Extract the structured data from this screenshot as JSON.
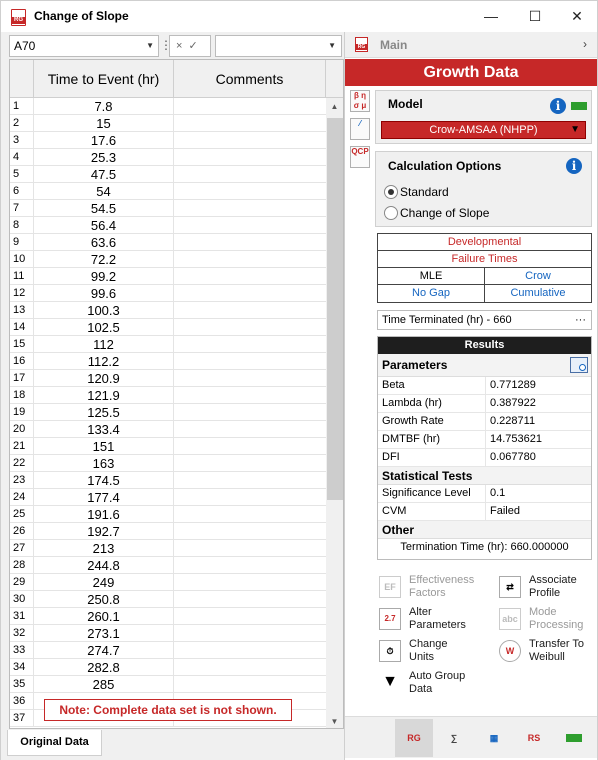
{
  "window": {
    "title": "Change of Slope",
    "minimize": "—",
    "maximize": "☐",
    "close": "✕",
    "icon_text": "RG"
  },
  "formula_bar": {
    "cell_ref": "A70",
    "cancel": "×",
    "accept": "✓"
  },
  "sheet": {
    "col_headers": [
      "Time to Event (hr)",
      "Comments"
    ],
    "rows": [
      {
        "n": "1",
        "v": "7.8"
      },
      {
        "n": "2",
        "v": "15"
      },
      {
        "n": "3",
        "v": "17.6"
      },
      {
        "n": "4",
        "v": "25.3"
      },
      {
        "n": "5",
        "v": "47.5"
      },
      {
        "n": "6",
        "v": "54"
      },
      {
        "n": "7",
        "v": "54.5"
      },
      {
        "n": "8",
        "v": "56.4"
      },
      {
        "n": "9",
        "v": "63.6"
      },
      {
        "n": "10",
        "v": "72.2"
      },
      {
        "n": "11",
        "v": "99.2"
      },
      {
        "n": "12",
        "v": "99.6"
      },
      {
        "n": "13",
        "v": "100.3"
      },
      {
        "n": "14",
        "v": "102.5"
      },
      {
        "n": "15",
        "v": "112"
      },
      {
        "n": "16",
        "v": "112.2"
      },
      {
        "n": "17",
        "v": "120.9"
      },
      {
        "n": "18",
        "v": "121.9"
      },
      {
        "n": "19",
        "v": "125.5"
      },
      {
        "n": "20",
        "v": "133.4"
      },
      {
        "n": "21",
        "v": "151"
      },
      {
        "n": "22",
        "v": "163"
      },
      {
        "n": "23",
        "v": "174.5"
      },
      {
        "n": "24",
        "v": "177.4"
      },
      {
        "n": "25",
        "v": "191.6"
      },
      {
        "n": "26",
        "v": "192.7"
      },
      {
        "n": "27",
        "v": "213"
      },
      {
        "n": "28",
        "v": "244.8"
      },
      {
        "n": "29",
        "v": "249"
      },
      {
        "n": "30",
        "v": "250.8"
      },
      {
        "n": "31",
        "v": "260.1"
      },
      {
        "n": "32",
        "v": "273.1"
      },
      {
        "n": "33",
        "v": "274.7"
      },
      {
        "n": "34",
        "v": "282.8"
      },
      {
        "n": "35",
        "v": "285"
      },
      {
        "n": "36",
        "v": ""
      },
      {
        "n": "37",
        "v": ""
      }
    ],
    "note": "Note: Complete data set is not shown.",
    "tab": "Original Data"
  },
  "panel": {
    "main_label": "Main",
    "header": "Growth Data",
    "model_title": "Model",
    "model_value": "Crow-AMSAA (NHPP)",
    "calc_title": "Calculation Options",
    "radio_standard": "Standard",
    "radio_cos": "Change of Slope",
    "opt_developmental": "Developmental",
    "opt_failure_times": "Failure Times",
    "opt_mle": "MLE",
    "opt_crow": "Crow",
    "opt_no_gap": "No Gap",
    "opt_cumulative": "Cumulative",
    "time_terminated": "Time Terminated (hr) - 660",
    "more": "···"
  },
  "results": {
    "header": "Results",
    "params_title": "Parameters",
    "params": [
      {
        "k": "Beta",
        "v": "0.771289"
      },
      {
        "k": "Lambda (hr)",
        "v": "0.387922"
      },
      {
        "k": "Growth Rate",
        "v": "0.228711"
      },
      {
        "k": "DMTBF (hr)",
        "v": "14.753621"
      },
      {
        "k": "DFI",
        "v": "0.067780"
      }
    ],
    "tests_title": "Statistical Tests",
    "tests": [
      {
        "k": "Significance Level",
        "v": "0.1"
      },
      {
        "k": "CVM",
        "v": "Failed"
      }
    ],
    "other_title": "Other",
    "termination": "Termination Time (hr): 660.000000"
  },
  "actions": {
    "effectiveness": [
      "Effectiveness",
      "Factors"
    ],
    "associate": [
      "Associate",
      "Profile"
    ],
    "alter": [
      "Alter",
      "Parameters"
    ],
    "mode": [
      "Mode",
      "Processing"
    ],
    "change_units": [
      "Change",
      "Units"
    ],
    "transfer": [
      "Transfer To",
      "Weibull"
    ],
    "autogroup": [
      "Auto Group",
      "Data"
    ]
  },
  "colors": {
    "accent_red": "#c62828",
    "info_blue": "#1565c0",
    "status_green": "#2e9e2e"
  }
}
